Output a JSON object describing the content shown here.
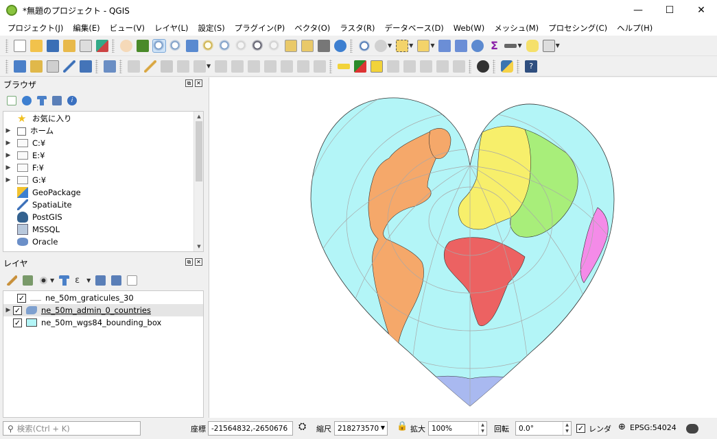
{
  "window": {
    "title": "*無題のプロジェクト - QGIS",
    "minimize": "—",
    "maximize": "☐",
    "close": "✕"
  },
  "menu": [
    "プロジェクト(J)",
    "編集(E)",
    "ビュー(V)",
    "レイヤ(L)",
    "設定(S)",
    "プラグイン(P)",
    "ベクタ(O)",
    "ラスタ(R)",
    "データベース(D)",
    "Web(W)",
    "メッシュ(M)",
    "プロセシング(C)",
    "ヘルプ(H)"
  ],
  "browser_panel": {
    "title": "ブラウザ",
    "items": [
      {
        "label": "お気に入り",
        "icon": "star-icon"
      },
      {
        "label": "ホーム",
        "icon": "home-icon"
      },
      {
        "label": "C:¥",
        "icon": "folder-icon"
      },
      {
        "label": "E:¥",
        "icon": "folder-icon"
      },
      {
        "label": "F:¥",
        "icon": "folder-icon"
      },
      {
        "label": "G:¥",
        "icon": "folder-icon"
      },
      {
        "label": "GeoPackage",
        "icon": "geopackage-icon"
      },
      {
        "label": "SpatiaLite",
        "icon": "spatialite-icon"
      },
      {
        "label": "PostGIS",
        "icon": "postgis-icon"
      },
      {
        "label": "MSSQL",
        "icon": "mssql-icon"
      },
      {
        "label": "Oracle",
        "icon": "oracle-icon"
      }
    ]
  },
  "layers_panel": {
    "title": "レイヤ",
    "layers": [
      {
        "name": "ne_50m_graticules_30",
        "checked": true,
        "symbol": "line-symbol"
      },
      {
        "name": "ne_50m_admin_0_countries",
        "checked": true,
        "symbol": "polygon-symbol",
        "selected": true
      },
      {
        "name": "ne_50m_wgs84_bounding_box",
        "checked": true,
        "symbol": "fill-symbol"
      }
    ]
  },
  "statusbar": {
    "search_placeholder": "検索(Ctrl + K)",
    "coord_label": "座標",
    "coord_value": "-21564832,-2650676",
    "scale_label": "縮尺",
    "scale_value": "218273570",
    "magnify_label": "拡大",
    "magnify_value": "100%",
    "rotation_label": "回転",
    "rotation_value": "0.0°",
    "render_label": "レンダ",
    "crs_value": "EPSG:54024"
  },
  "map": {
    "projection_fill": "#b3f5f7",
    "colors": {
      "americas": "#f5a86a",
      "europe_north_asia": "#f7ef6b",
      "asia_east": "#a8ee7a",
      "africa": "#ec6262",
      "oceania": "#f48be8",
      "antarctica": "#a9b9f0",
      "graticule": "#a8a8a8"
    }
  }
}
